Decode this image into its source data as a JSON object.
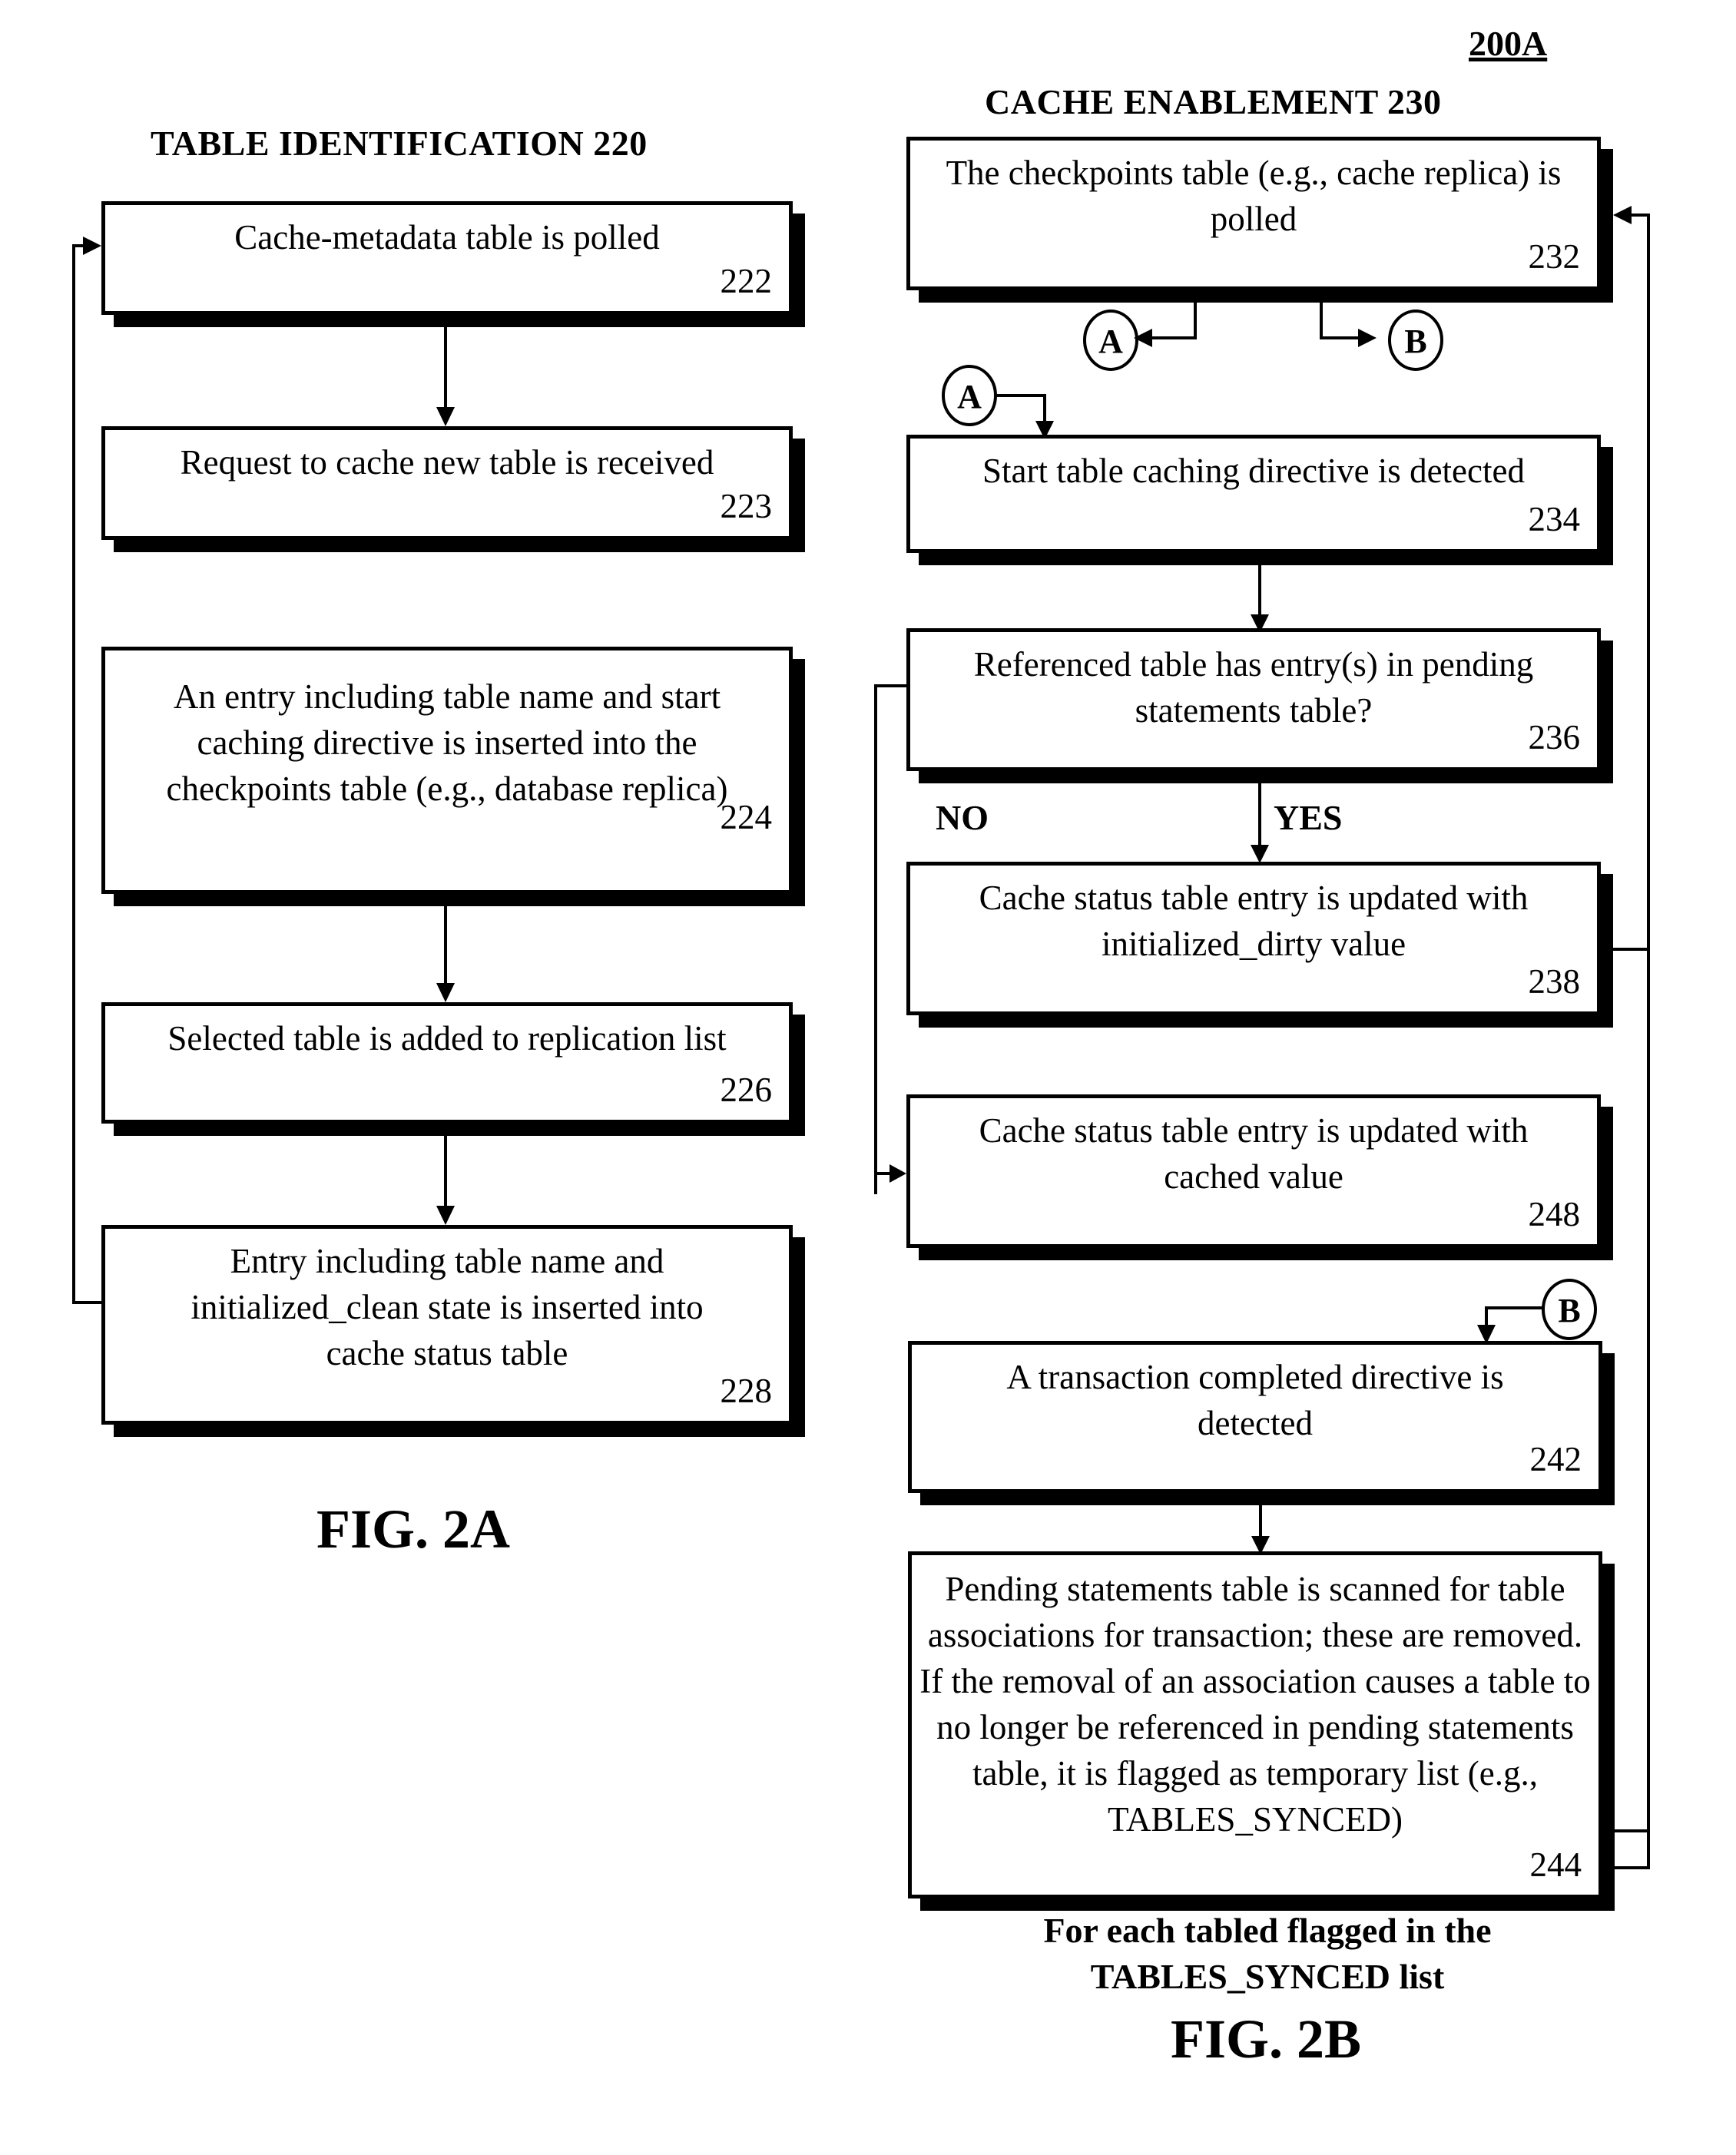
{
  "figure_ref": "200A",
  "left": {
    "heading": "TABLE IDENTIFICATION 220",
    "figure_label": "FIG. 2A",
    "boxes": [
      {
        "text": "Cache-metadata table is polled",
        "num": "222"
      },
      {
        "text": "Request to cache new table is received",
        "num": "223"
      },
      {
        "text": "An entry including table name and start caching directive is inserted into the checkpoints table (e.g., database replica)",
        "num": "224"
      },
      {
        "text": "Selected table is added to replication list",
        "num": "226"
      },
      {
        "text": "Entry including table name and initialized_clean state is inserted into cache status table",
        "num": "228"
      }
    ]
  },
  "right": {
    "heading": "CACHE ENABLEMENT 230",
    "figure_label": "FIG. 2B",
    "boxes": [
      {
        "text": "The checkpoints table (e.g., cache replica) is polled",
        "num": "232"
      },
      {
        "text": "Start table caching directive is detected",
        "num": "234"
      },
      {
        "text": "Referenced table has entry(s) in pending statements table?",
        "num": "236"
      },
      {
        "text": "Cache status table entry is updated with initialized_dirty value",
        "num": "238"
      },
      {
        "text": "Cache status table entry is updated with cached value",
        "num": "248"
      },
      {
        "text": "A transaction completed directive is detected",
        "num": "242"
      },
      {
        "text": "Pending statements table is scanned for table associations for transaction; these are removed.  If the removal of an association causes a table to no longer be referenced in pending statements table, it is flagged as temporary list (e.g., TABLES_SYNCED)",
        "num": "244"
      }
    ],
    "decision_labels": {
      "no": "NO",
      "yes": "YES"
    },
    "connectors": {
      "a": "A",
      "b": "B"
    },
    "loop_note": "For each tabled flagged in the TABLES_SYNCED list"
  }
}
